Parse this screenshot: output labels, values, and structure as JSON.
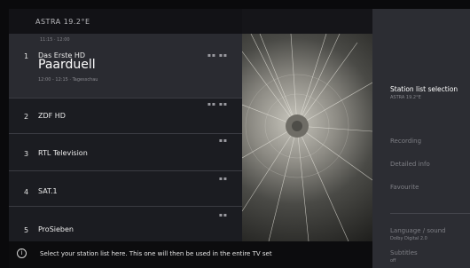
{
  "list": {
    "title": "ASTRA 19.2°E",
    "channels": [
      {
        "num": "1",
        "name": "Das Erste HD",
        "badge": "▪▪ ▪▪",
        "prev": "11:15 · 12:00",
        "show": "Paarduell",
        "time": "12:00 - 12:15 · Tagesschau"
      },
      {
        "num": "2",
        "name": "ZDF HD",
        "badge": "▪▪ ▪▪"
      },
      {
        "num": "3",
        "name": "RTL Television",
        "badge": "▪▪"
      },
      {
        "num": "4",
        "name": "SAT.1",
        "badge": "▪▪"
      },
      {
        "num": "5",
        "name": "ProSieben",
        "badge": "▪▪"
      }
    ]
  },
  "menu": {
    "active_label": "Station list selection",
    "active_sub": "ASTRA 19.2°E",
    "recording": "Recording",
    "detailed_info": "Detailed info",
    "favourite": "Favourite",
    "language_sound": "Language / sound",
    "language_sub": "Dolby Digital 2.0",
    "subtitles": "Subtitles",
    "subtitles_sub": "off"
  },
  "info": {
    "icon": "i",
    "text": "Select your station list here. This one will then be used in the entire TV set"
  },
  "colors": {
    "panel_bg": "#1b1c21",
    "menu_bg": "#2c2d33",
    "selected_row": "#2a2b31"
  }
}
